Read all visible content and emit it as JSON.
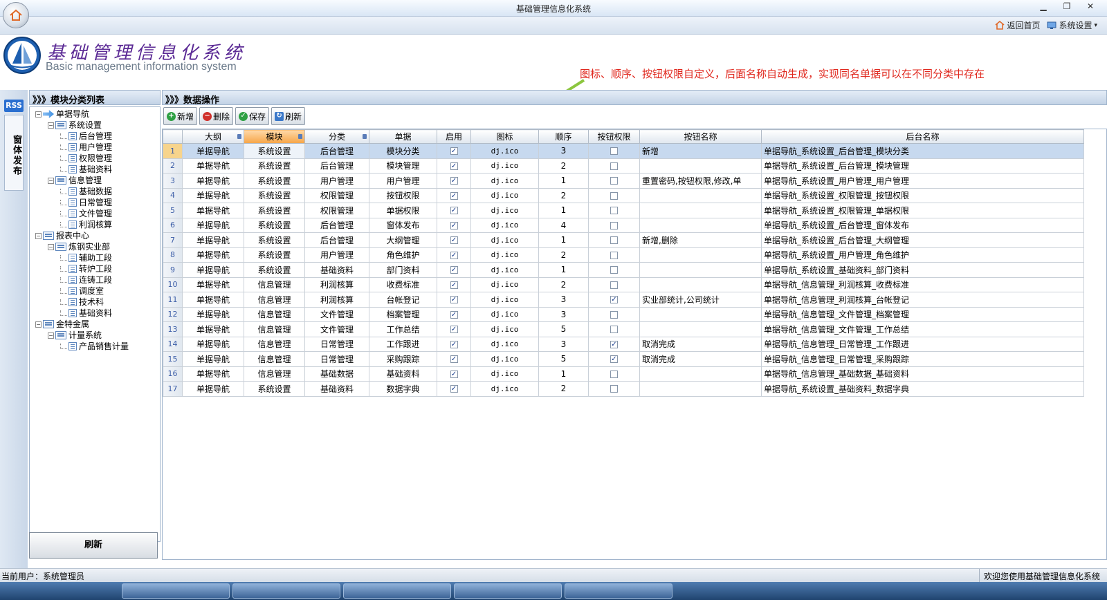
{
  "window": {
    "title": "基础管理信息化系统"
  },
  "menu": {
    "home_label": "返回首页",
    "settings_label": "系统设置"
  },
  "header": {
    "brand_cn": "基础管理信息化系统",
    "brand_en": "Basic management information system",
    "annotation": "图标、顺序、按钮权限自定义，后面名称自动生成，实现同名单据可以在不同分类中存在"
  },
  "side": {
    "rss": "RSS",
    "vtab": "窗体发布"
  },
  "left": {
    "title": "》》》模块分类列表",
    "refresh_label": "刷新",
    "tree": [
      {
        "label": "单据导航",
        "level": 0,
        "type": "root-arrow",
        "exp": "−"
      },
      {
        "label": "系统设置",
        "level": 1,
        "type": "folder",
        "exp": "−"
      },
      {
        "label": "后台管理",
        "level": 2,
        "type": "leaf"
      },
      {
        "label": "用户管理",
        "level": 2,
        "type": "leaf"
      },
      {
        "label": "权限管理",
        "level": 2,
        "type": "leaf"
      },
      {
        "label": "基础资料",
        "level": 2,
        "type": "leaf"
      },
      {
        "label": "信息管理",
        "level": 1,
        "type": "folder",
        "exp": "−"
      },
      {
        "label": "基础数据",
        "level": 2,
        "type": "leaf"
      },
      {
        "label": "日常管理",
        "level": 2,
        "type": "leaf"
      },
      {
        "label": "文件管理",
        "level": 2,
        "type": "leaf"
      },
      {
        "label": "利润核算",
        "level": 2,
        "type": "leaf"
      },
      {
        "label": "报表中心",
        "level": 0,
        "type": "root-folder",
        "exp": "−"
      },
      {
        "label": "炼钢实业部",
        "level": 1,
        "type": "folder",
        "exp": "−"
      },
      {
        "label": "辅助工段",
        "level": 2,
        "type": "leaf"
      },
      {
        "label": "转炉工段",
        "level": 2,
        "type": "leaf"
      },
      {
        "label": "连铸工段",
        "level": 2,
        "type": "leaf"
      },
      {
        "label": "调度室",
        "level": 2,
        "type": "leaf"
      },
      {
        "label": "技术科",
        "level": 2,
        "type": "leaf"
      },
      {
        "label": "基础资料",
        "level": 2,
        "type": "leaf"
      },
      {
        "label": "金特金属",
        "level": 0,
        "type": "root-folder",
        "exp": "−"
      },
      {
        "label": "计量系统",
        "level": 1,
        "type": "folder",
        "exp": "−"
      },
      {
        "label": "产品销售计量",
        "level": 2,
        "type": "leaf"
      }
    ]
  },
  "right": {
    "title": "》》》数据操作",
    "toolbar": {
      "add": "新增",
      "delete": "删除",
      "save": "保存",
      "refresh": "刷新"
    },
    "columns": [
      "大纲",
      "模块",
      "分类",
      "单据",
      "启用",
      "图标",
      "顺序",
      "按钮权限",
      "按钮名称",
      "后台名称"
    ],
    "rows": [
      {
        "n": "1",
        "outline": "单据导航",
        "module": "系统设置",
        "category": "后台管理",
        "doc": "模块分类",
        "enabled": true,
        "icon": "dj.ico",
        "order": "3",
        "perm": false,
        "btn": "新增",
        "backend": "单据导航_系统设置_后台管理_模块分类"
      },
      {
        "n": "2",
        "outline": "单据导航",
        "module": "系统设置",
        "category": "后台管理",
        "doc": "模块管理",
        "enabled": true,
        "icon": "dj.ico",
        "order": "2",
        "perm": false,
        "btn": "",
        "backend": "单据导航_系统设置_后台管理_模块管理"
      },
      {
        "n": "3",
        "outline": "单据导航",
        "module": "系统设置",
        "category": "用户管理",
        "doc": "用户管理",
        "enabled": true,
        "icon": "dj.ico",
        "order": "1",
        "perm": false,
        "btn": "重置密码,按钮权限,修改,单",
        "backend": "单据导航_系统设置_用户管理_用户管理"
      },
      {
        "n": "4",
        "outline": "单据导航",
        "module": "系统设置",
        "category": "权限管理",
        "doc": "按钮权限",
        "enabled": true,
        "icon": "dj.ico",
        "order": "2",
        "perm": false,
        "btn": "",
        "backend": "单据导航_系统设置_权限管理_按钮权限"
      },
      {
        "n": "5",
        "outline": "单据导航",
        "module": "系统设置",
        "category": "权限管理",
        "doc": "单据权限",
        "enabled": true,
        "icon": "dj.ico",
        "order": "1",
        "perm": false,
        "btn": "",
        "backend": "单据导航_系统设置_权限管理_单据权限"
      },
      {
        "n": "6",
        "outline": "单据导航",
        "module": "系统设置",
        "category": "后台管理",
        "doc": "窗体发布",
        "enabled": true,
        "icon": "dj.ico",
        "order": "4",
        "perm": false,
        "btn": "",
        "backend": "单据导航_系统设置_后台管理_窗体发布"
      },
      {
        "n": "7",
        "outline": "单据导航",
        "module": "系统设置",
        "category": "后台管理",
        "doc": "大纲管理",
        "enabled": true,
        "icon": "dj.ico",
        "order": "1",
        "perm": false,
        "btn": "新增,删除",
        "backend": "单据导航_系统设置_后台管理_大纲管理"
      },
      {
        "n": "8",
        "outline": "单据导航",
        "module": "系统设置",
        "category": "用户管理",
        "doc": "角色维护",
        "enabled": true,
        "icon": "dj.ico",
        "order": "2",
        "perm": false,
        "btn": "",
        "backend": "单据导航_系统设置_用户管理_角色维护"
      },
      {
        "n": "9",
        "outline": "单据导航",
        "module": "系统设置",
        "category": "基础资料",
        "doc": "部门资料",
        "enabled": true,
        "icon": "dj.ico",
        "order": "1",
        "perm": false,
        "btn": "",
        "backend": "单据导航_系统设置_基础资料_部门资料"
      },
      {
        "n": "10",
        "outline": "单据导航",
        "module": "信息管理",
        "category": "利润核算",
        "doc": "收费标准",
        "enabled": true,
        "icon": "dj.ico",
        "order": "2",
        "perm": false,
        "btn": "",
        "backend": "单据导航_信息管理_利润核算_收费标准"
      },
      {
        "n": "11",
        "outline": "单据导航",
        "module": "信息管理",
        "category": "利润核算",
        "doc": "台帐登记",
        "enabled": true,
        "icon": "dj.ico",
        "order": "3",
        "perm": true,
        "btn": "实业部统计,公司统计",
        "backend": "单据导航_信息管理_利润核算_台帐登记"
      },
      {
        "n": "12",
        "outline": "单据导航",
        "module": "信息管理",
        "category": "文件管理",
        "doc": "档案管理",
        "enabled": true,
        "icon": "dj.ico",
        "order": "3",
        "perm": false,
        "btn": "",
        "backend": "单据导航_信息管理_文件管理_档案管理"
      },
      {
        "n": "13",
        "outline": "单据导航",
        "module": "信息管理",
        "category": "文件管理",
        "doc": "工作总结",
        "enabled": true,
        "icon": "dj.ico",
        "order": "5",
        "perm": false,
        "btn": "",
        "backend": "单据导航_信息管理_文件管理_工作总结"
      },
      {
        "n": "14",
        "outline": "单据导航",
        "module": "信息管理",
        "category": "日常管理",
        "doc": "工作跟进",
        "enabled": true,
        "icon": "dj.ico",
        "order": "3",
        "perm": true,
        "btn": "取消完成",
        "backend": "单据导航_信息管理_日常管理_工作跟进"
      },
      {
        "n": "15",
        "outline": "单据导航",
        "module": "信息管理",
        "category": "日常管理",
        "doc": "采购跟踪",
        "enabled": true,
        "icon": "dj.ico",
        "order": "5",
        "perm": true,
        "btn": "取消完成",
        "backend": "单据导航_信息管理_日常管理_采购跟踪"
      },
      {
        "n": "16",
        "outline": "单据导航",
        "module": "信息管理",
        "category": "基础数据",
        "doc": "基础资料",
        "enabled": true,
        "icon": "dj.ico",
        "order": "1",
        "perm": false,
        "btn": "",
        "backend": "单据导航_信息管理_基础数据_基础资料"
      },
      {
        "n": "17",
        "outline": "单据导航",
        "module": "系统设置",
        "category": "基础资料",
        "doc": "数据字典",
        "enabled": true,
        "icon": "dj.ico",
        "order": "2",
        "perm": false,
        "btn": "",
        "backend": "单据导航_系统设置_基础资料_数据字典"
      }
    ]
  },
  "status": {
    "left": "当前用户：系统管理员",
    "right": "欢迎您使用基础管理信息化系统"
  },
  "colors": {
    "accent": "#5b2a95",
    "annotation": "#e0281e",
    "selected_row": "#c7d9ef",
    "header_sorted": "#f6a547"
  }
}
